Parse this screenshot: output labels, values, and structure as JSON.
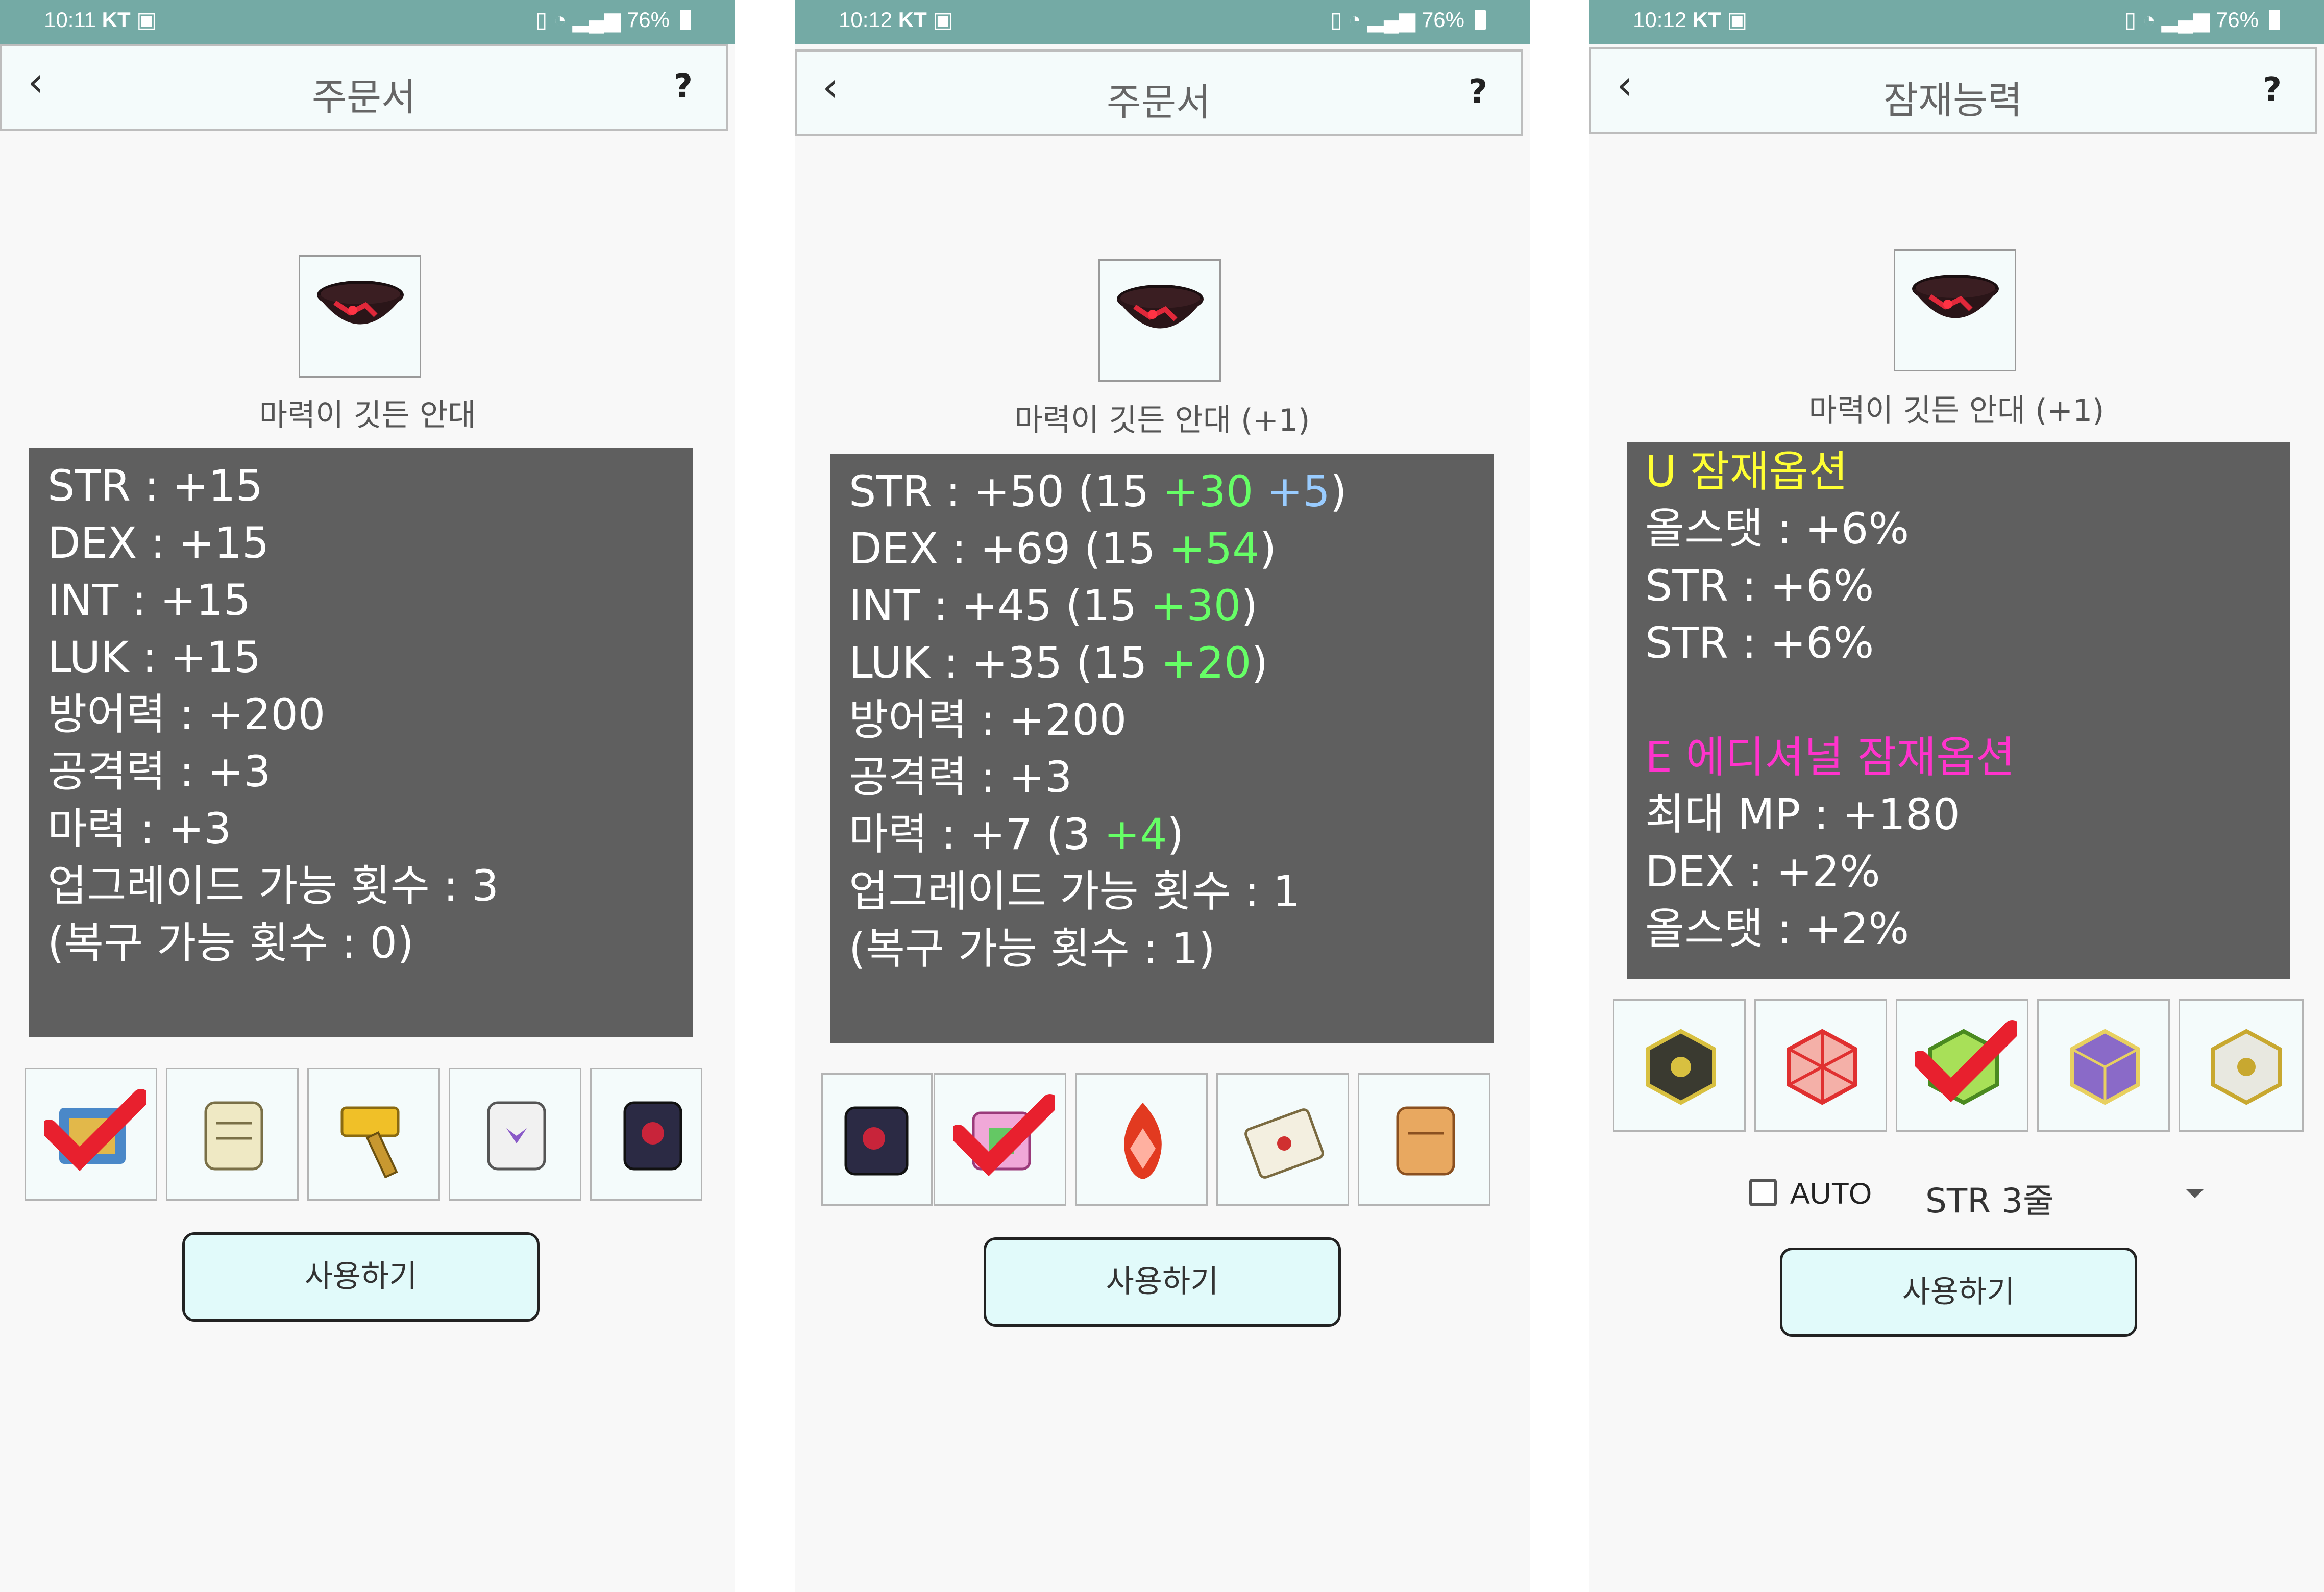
{
  "colors": {
    "statusbar": "#74aaa5",
    "stats_bg": "#5f5f5f",
    "green": "#66ff66",
    "blue": "#99ccff",
    "yellow": "#ffff33",
    "magenta": "#ff33cc",
    "button_bg": "#e1fafa"
  },
  "screens": [
    {
      "status": {
        "time": "10:11",
        "carrier": "KT",
        "battery": "76%"
      },
      "header": {
        "back": "‹",
        "title": "주문서",
        "help": "?"
      },
      "item": {
        "icon": "bowl-icon",
        "name": "마력이 깃든 안대"
      },
      "stats": [
        {
          "parts": [
            {
              "t": "STR : +15",
              "c": "w"
            }
          ]
        },
        {
          "parts": [
            {
              "t": "DEX : +15",
              "c": "w"
            }
          ]
        },
        {
          "parts": [
            {
              "t": "INT : +15",
              "c": "w"
            }
          ]
        },
        {
          "parts": [
            {
              "t": "LUK : +15",
              "c": "w"
            }
          ]
        },
        {
          "parts": [
            {
              "t": "방어력 : +200",
              "c": "w"
            }
          ]
        },
        {
          "parts": [
            {
              "t": "공격력 : +3",
              "c": "w"
            }
          ]
        },
        {
          "parts": [
            {
              "t": "마력 : +3",
              "c": "w"
            }
          ]
        },
        {
          "parts": [
            {
              "t": "업그레이드 가능 횟수 : 3",
              "c": "w"
            }
          ]
        },
        {
          "parts": [
            {
              "t": "(복구 가능 횟수 : 0)",
              "c": "w"
            }
          ]
        }
      ],
      "slots": [
        {
          "icon": "spell-trace-icon",
          "checked": true
        },
        {
          "icon": "scroll-icon",
          "checked": false
        },
        {
          "icon": "hammer-icon",
          "checked": false
        },
        {
          "icon": "innocence-scroll-icon",
          "checked": false
        },
        {
          "icon": "chaos-scroll-icon",
          "checked": false
        }
      ],
      "use_button": "사용하기"
    },
    {
      "status": {
        "time": "10:12",
        "carrier": "KT",
        "battery": "76%"
      },
      "header": {
        "back": "‹",
        "title": "주문서",
        "help": "?"
      },
      "item": {
        "icon": "bowl-icon",
        "name": "마력이 깃든 안대 (+1)"
      },
      "stats": [
        {
          "parts": [
            {
              "t": "STR : +50 (15 ",
              "c": "w"
            },
            {
              "t": "+30",
              "c": "g"
            },
            {
              "t": " ",
              "c": "w"
            },
            {
              "t": "+5",
              "c": "b"
            },
            {
              "t": ")",
              "c": "w"
            }
          ]
        },
        {
          "parts": [
            {
              "t": "DEX : +69 (15 ",
              "c": "w"
            },
            {
              "t": "+54",
              "c": "g"
            },
            {
              "t": ")",
              "c": "w"
            }
          ]
        },
        {
          "parts": [
            {
              "t": "INT : +45 (15 ",
              "c": "w"
            },
            {
              "t": "+30",
              "c": "g"
            },
            {
              "t": ")",
              "c": "w"
            }
          ]
        },
        {
          "parts": [
            {
              "t": "LUK : +35 (15 ",
              "c": "w"
            },
            {
              "t": "+20",
              "c": "g"
            },
            {
              "t": ")",
              "c": "w"
            }
          ]
        },
        {
          "parts": [
            {
              "t": "방어력 : +200",
              "c": "w"
            }
          ]
        },
        {
          "parts": [
            {
              "t": "공격력 : +3",
              "c": "w"
            }
          ]
        },
        {
          "parts": [
            {
              "t": "마력 : +7 (3 ",
              "c": "w"
            },
            {
              "t": "+4",
              "c": "g"
            },
            {
              "t": ")",
              "c": "w"
            }
          ]
        },
        {
          "parts": [
            {
              "t": "업그레이드 가능 횟수 : 1",
              "c": "w"
            }
          ]
        },
        {
          "parts": [
            {
              "t": "(복구 가능 횟수 : 1)",
              "c": "w"
            }
          ]
        }
      ],
      "slots": [
        {
          "icon": "chaos-scroll-icon",
          "checked": false
        },
        {
          "icon": "magic-scroll-icon",
          "checked": true
        },
        {
          "icon": "fire-crystal-icon",
          "checked": false
        },
        {
          "icon": "map-scroll-icon",
          "checked": false
        },
        {
          "icon": "old-scroll-icon",
          "checked": false
        }
      ],
      "use_button": "사용하기"
    },
    {
      "status": {
        "time": "10:12",
        "carrier": "KT",
        "battery": "76%"
      },
      "header": {
        "back": "‹",
        "title": "잠재능력",
        "help": "?"
      },
      "item": {
        "icon": "bowl-icon",
        "name": "마력이 깃든 안대 (+1)"
      },
      "stats": [
        {
          "parts": [
            {
              "t": "U 잠재옵션",
              "c": "y"
            }
          ]
        },
        {
          "parts": [
            {
              "t": "올스탯 : +6%",
              "c": "w"
            }
          ]
        },
        {
          "parts": [
            {
              "t": "STR : +6%",
              "c": "w"
            }
          ]
        },
        {
          "parts": [
            {
              "t": "STR : +6%",
              "c": "w"
            }
          ]
        },
        {
          "parts": [
            {
              "t": "",
              "c": "w"
            }
          ]
        },
        {
          "parts": [
            {
              "t": "E 에디셔널 잠재옵션",
              "c": "m"
            }
          ]
        },
        {
          "parts": [
            {
              "t": "최대 MP : +180",
              "c": "w"
            }
          ]
        },
        {
          "parts": [
            {
              "t": "DEX : +2%",
              "c": "w"
            }
          ]
        },
        {
          "parts": [
            {
              "t": "올스탯 : +2%",
              "c": "w"
            }
          ]
        }
      ],
      "slots": [
        {
          "icon": "black-cube-icon",
          "checked": false
        },
        {
          "icon": "red-cube-icon",
          "checked": false
        },
        {
          "icon": "green-cube-icon",
          "checked": true
        },
        {
          "icon": "purple-cube-icon",
          "checked": false
        },
        {
          "icon": "white-cube-icon",
          "checked": false
        }
      ],
      "auto": {
        "label": "AUTO",
        "checked": false,
        "selected": "STR 3줄"
      },
      "use_button": "사용하기"
    }
  ]
}
